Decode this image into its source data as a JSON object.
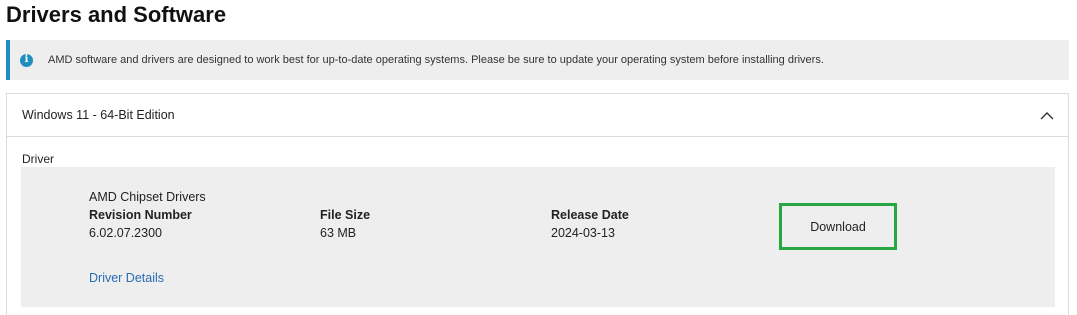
{
  "page": {
    "title": "Drivers and Software"
  },
  "notice": {
    "icon": "info-icon",
    "text": "AMD software and drivers are designed to work best for up-to-date operating systems. Please be sure to update your operating system before installing drivers.",
    "accent_color": "#1f8ebf"
  },
  "accordion": {
    "title": "Windows 11 - 64-Bit Edition",
    "expanded": true,
    "toggle_icon": "chevron-up-icon"
  },
  "section": {
    "label": "Driver"
  },
  "driver": {
    "name": "AMD Chipset Drivers",
    "revision_label": "Revision Number",
    "revision_value": "6.02.07.2300",
    "size_label": "File Size",
    "size_value": "63 MB",
    "date_label": "Release Date",
    "date_value": "2024-03-13",
    "download_label": "Download",
    "details_link": "Driver Details",
    "highlight_color": "#27a644"
  }
}
